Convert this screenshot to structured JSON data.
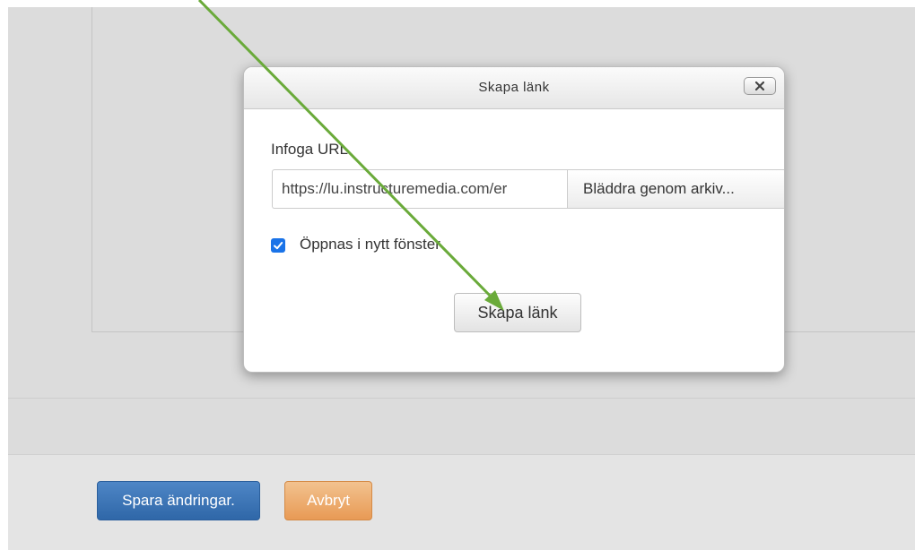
{
  "dialog": {
    "title": "Skapa länk",
    "close_icon": "close-icon",
    "url_label": "Infoga URL",
    "url_value": "https://lu.instructuremedia.com/er",
    "browse_label": "Bläddra genom arkiv...",
    "open_new_window_label": "Öppnas i nytt fönster",
    "open_new_window_checked": true,
    "create_label": "Skapa länk"
  },
  "footer": {
    "save_label": "Spara ändringar.",
    "cancel_label": "Avbryt"
  },
  "colors": {
    "save_button": "#3a74b8",
    "cancel_button": "#eda667",
    "checkbox": "#1a73e8",
    "annotation_arrow": "#6aaa3a"
  },
  "annotation": {
    "icon": "arrow-icon"
  }
}
